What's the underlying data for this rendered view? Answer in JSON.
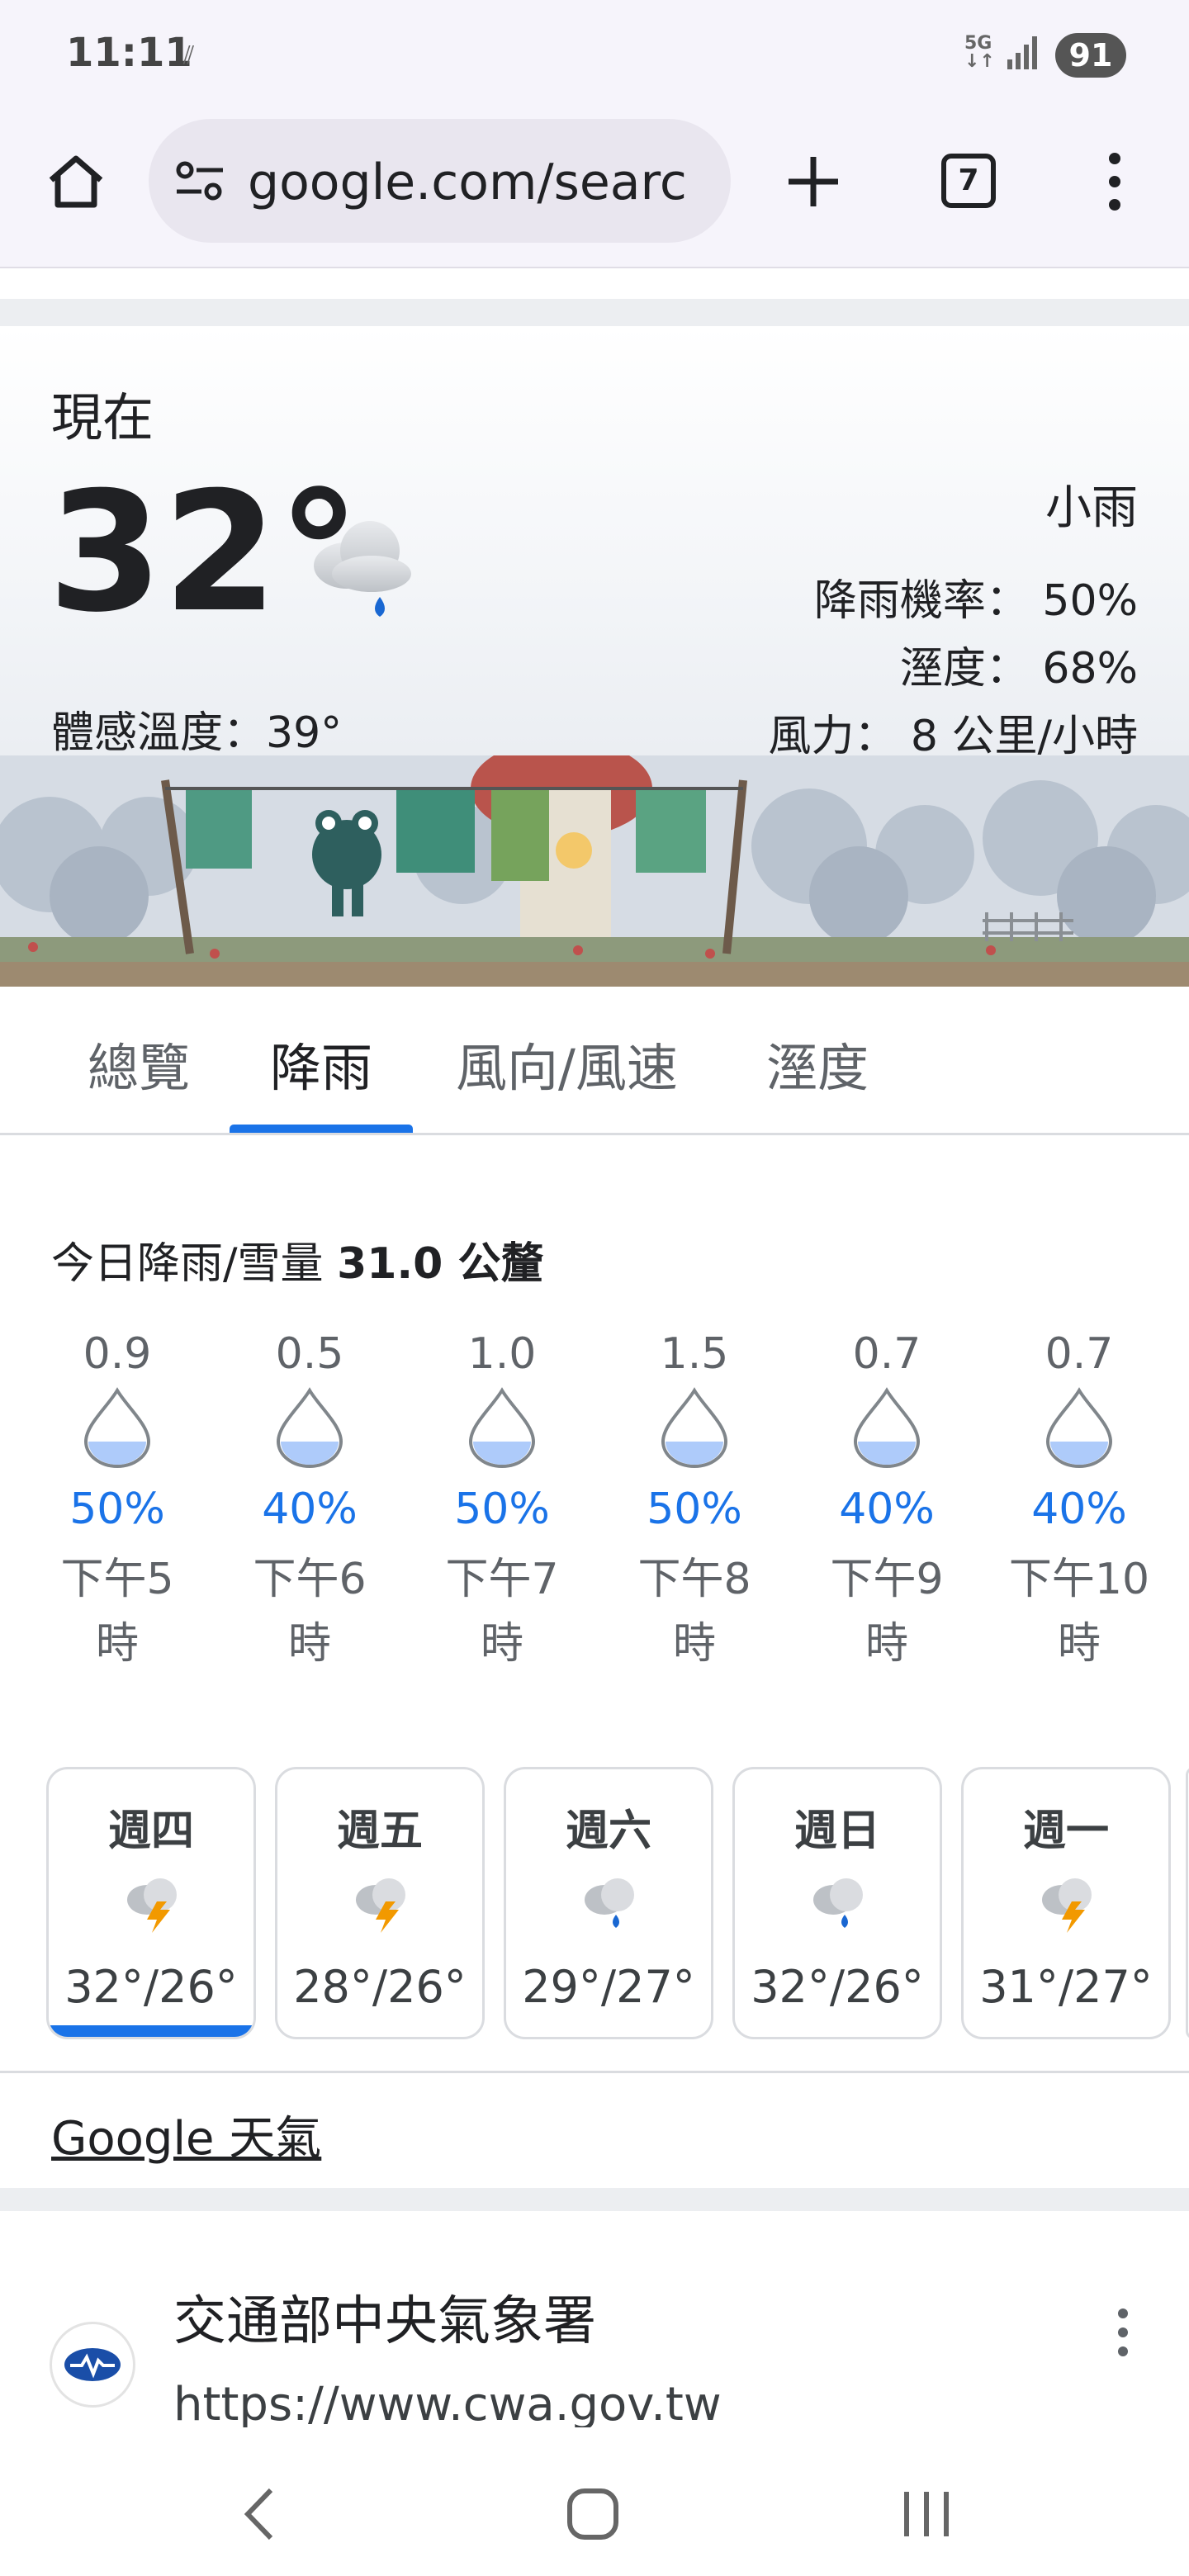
{
  "status_bar": {
    "time": "11:11",
    "network": "5G",
    "battery": "91"
  },
  "browser": {
    "url": "google.com/searc",
    "tab_count": "7"
  },
  "weather": {
    "now_label": "現在",
    "temperature": "32°",
    "feels_like": "體感溫度：39°",
    "condition": "小雨",
    "precip_chance": "降雨機率： 50%",
    "humidity": "溼度： 68%",
    "wind": "風力： 8 公里/小時"
  },
  "tabs": [
    "總覽",
    "降雨",
    "風向/風速",
    "溼度"
  ],
  "active_tab": "降雨",
  "precipitation": {
    "title_prefix": "今日降雨/雪量",
    "total": "31.0 公釐",
    "hours": [
      {
        "amount": "0.9",
        "chance": "50%",
        "time_line1": "下午5",
        "time_line2": "時"
      },
      {
        "amount": "0.5",
        "chance": "40%",
        "time_line1": "下午6",
        "time_line2": "時"
      },
      {
        "amount": "1.0",
        "chance": "50%",
        "time_line1": "下午7",
        "time_line2": "時"
      },
      {
        "amount": "1.5",
        "chance": "50%",
        "time_line1": "下午8",
        "time_line2": "時"
      },
      {
        "amount": "0.7",
        "chance": "40%",
        "time_line1": "下午9",
        "time_line2": "時"
      },
      {
        "amount": "0.7",
        "chance": "40%",
        "time_line1": "下午10",
        "time_line2": "時"
      }
    ]
  },
  "daily": [
    {
      "day": "週四",
      "temps": "32°/26°",
      "icon": "thunderstorm-icon",
      "selected": true
    },
    {
      "day": "週五",
      "temps": "28°/26°",
      "icon": "thunderstorm-icon",
      "selected": false
    },
    {
      "day": "週六",
      "temps": "29°/27°",
      "icon": "rain-icon",
      "selected": false
    },
    {
      "day": "週日",
      "temps": "32°/26°",
      "icon": "rain-icon",
      "selected": false
    },
    {
      "day": "週一",
      "temps": "31°/27°",
      "icon": "thunderstorm-icon",
      "selected": false
    }
  ],
  "google_weather_link": "Google 天氣",
  "result": {
    "title": "交通部中央氣象署",
    "url": "https://www.cwa.gov.tw"
  },
  "colors": {
    "accent": "#1a73e8",
    "drop_fill": "#aecbfa"
  }
}
